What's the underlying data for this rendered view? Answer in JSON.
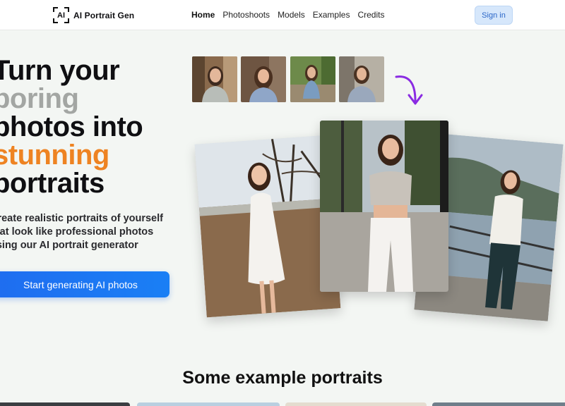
{
  "header": {
    "logo_mark": "AI",
    "brand": "AI Portrait Gen",
    "nav": [
      {
        "label": "Home",
        "active": true
      },
      {
        "label": "Photoshoots",
        "active": false
      },
      {
        "label": "Models",
        "active": false
      },
      {
        "label": "Examples",
        "active": false
      },
      {
        "label": "Credits",
        "active": false
      }
    ],
    "signin": "Sign in"
  },
  "hero": {
    "title_lines": [
      "Turn your",
      "boring",
      "photos into",
      "stunning",
      "portraits"
    ],
    "subtitle_lines": [
      "Create realistic portraits of yourself",
      "that look like professional photos",
      "using our AI portrait generator"
    ],
    "cta": "Start generating AI photos"
  },
  "colors": {
    "accent_blue": "#1f6df0",
    "accent_orange": "#ee8322",
    "muted_gray": "#a3a6a3",
    "arrow_purple": "#8a2be2"
  },
  "icons": {
    "arrow": "curved-arrow-down-icon"
  },
  "examples": {
    "title": "Some example portraits"
  }
}
